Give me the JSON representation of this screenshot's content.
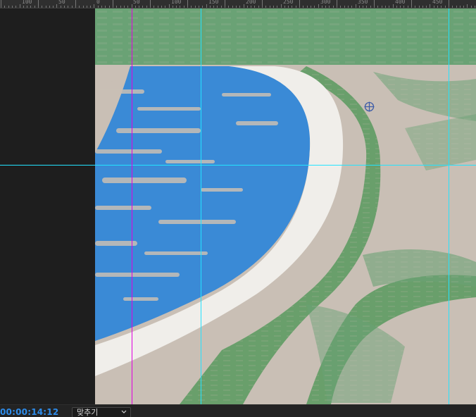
{
  "ruler": {
    "labels": [
      "100",
      "50",
      "0",
      "50",
      "100",
      "150",
      "200",
      "250",
      "300",
      "350",
      "400",
      "450"
    ]
  },
  "canvas": {
    "anchor_icon": "crosshair-circle-icon"
  },
  "footer": {
    "timecode": "00:00:14:12",
    "fit_label": "맞추기",
    "dropdown_icon": "chevron-down-icon"
  },
  "colors": {
    "timecode": "#2d8ceb",
    "guide_cyan": "#23e3ff",
    "guide_magenta": "#e000e0",
    "court_blue": "#3a8ad6",
    "court_line": "#f2f0ec",
    "court_green": "#5a9a5e",
    "court_beige": "#c9bfb5"
  }
}
